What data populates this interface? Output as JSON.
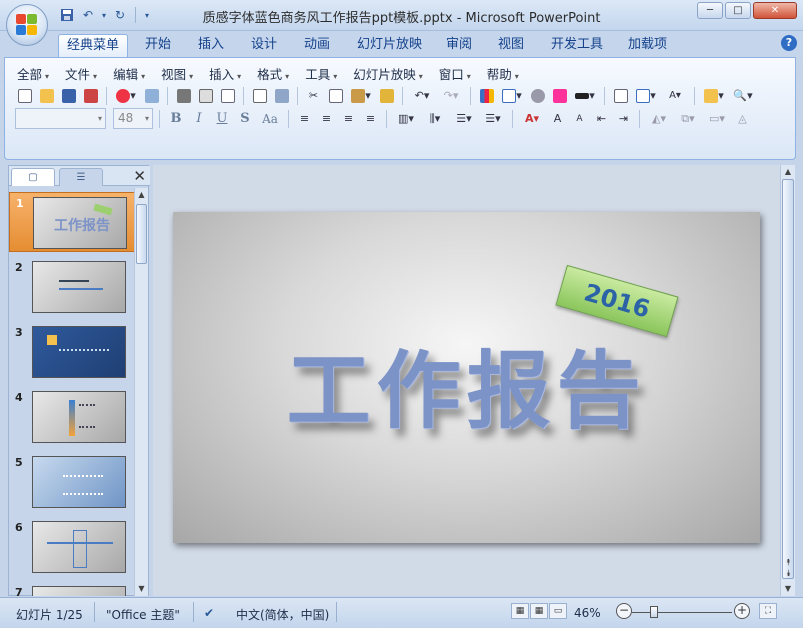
{
  "window": {
    "title": "质感字体蓝色商务风工作报告ppt模板.pptx - Microsoft PowerPoint",
    "minimize_icon": "minimize-icon",
    "maximize_icon": "maximize-icon",
    "close_icon": "close-icon"
  },
  "ribbon_tabs": [
    "经典菜单",
    "开始",
    "插入",
    "设计",
    "动画",
    "幻灯片放映",
    "审阅",
    "视图",
    "开发工具",
    "加载项"
  ],
  "menus": [
    "全部",
    "文件",
    "编辑",
    "视图",
    "插入",
    "格式",
    "工具",
    "幻灯片放映",
    "窗口",
    "帮助"
  ],
  "font": {
    "name_value": "",
    "size_value": "48"
  },
  "format_buttons": [
    "B",
    "I",
    "U",
    "S",
    "Aa"
  ],
  "slides_panel": {
    "slide_numbers": [
      "1",
      "2",
      "3",
      "4",
      "5",
      "6",
      "7"
    ],
    "selected": 1
  },
  "slide": {
    "title": "工作报告",
    "year": "2016"
  },
  "status": {
    "slide_info": "幻灯片 1/25",
    "theme": "\"Office 主题\"",
    "language": "中文(简体，中国)",
    "zoom": "46%"
  },
  "colors": {
    "title_blue": "#7c93c8",
    "badge_green": "#8bc65c",
    "selected_thumb": "#e58d32",
    "ribbon_bg": "#dbe7f6"
  }
}
